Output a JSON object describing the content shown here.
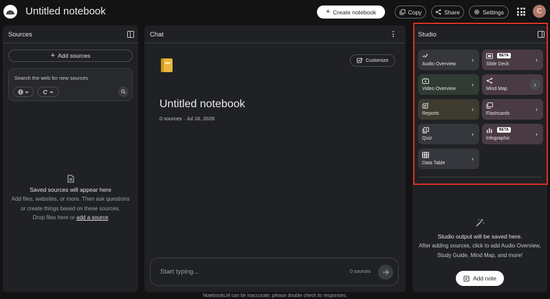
{
  "header": {
    "title": "Untitled notebook",
    "create_label": "Create notebook",
    "copy_label": "Copy",
    "share_label": "Share",
    "settings_label": "Settings",
    "avatar_initial": "C"
  },
  "sources": {
    "title": "Sources",
    "add_label": "Add sources",
    "search_placeholder": "Search the web for new sources",
    "empty_title": "Saved sources will appear here",
    "empty_line1": "Add files, websites, or more. Then ask questions",
    "empty_line2": "or create things based on these sources.",
    "empty_line3": "Drop files here or",
    "empty_link": "add a source"
  },
  "chat": {
    "title": "Chat",
    "customize_label": "Customize",
    "notebook_title": "Untitled notebook",
    "meta": "0 sources · Jul 16, 2026",
    "input_placeholder": "Start typing...",
    "source_count": "0 sources"
  },
  "studio": {
    "title": "Studio",
    "beta_label": "BETA",
    "tiles": [
      {
        "label": "Audio Overview",
        "color": "#36373d"
      },
      {
        "label": "Slide Deck",
        "color": "#4a3b43"
      },
      {
        "label": "Video Overview",
        "color": "#2f3b33"
      },
      {
        "label": "Mind Map",
        "color": "#4a3b43"
      },
      {
        "label": "Reports",
        "color": "#3d3b2f"
      },
      {
        "label": "Flashcards",
        "color": "#4a3b43"
      },
      {
        "label": "Quiz",
        "color": "#36373d"
      },
      {
        "label": "Infographic",
        "color": "#4a3b43"
      },
      {
        "label": "Data Table",
        "color": "#36373d"
      }
    ],
    "empty_title": "Studio output will be saved here.",
    "empty_line1": "After adding sources, click to add Audio Overview,",
    "empty_line2": "Study Guide, Mind Map, and more!",
    "add_note_label": "Add note"
  },
  "footer": "NotebookLM can be inaccurate; please double check its responses.",
  "colors": {
    "background": "#131314",
    "panel": "#202124",
    "highlight": "#d93025"
  }
}
